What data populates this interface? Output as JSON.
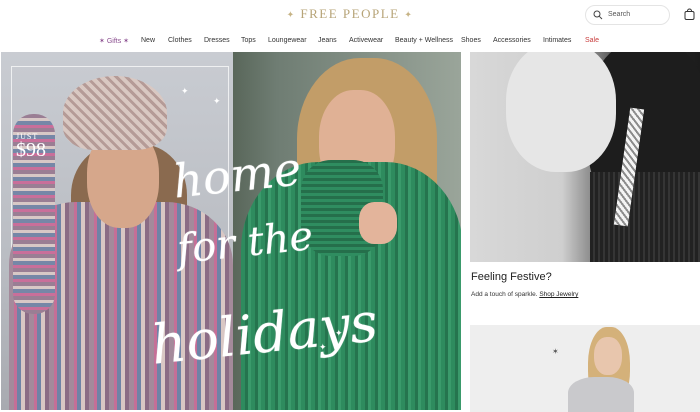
{
  "header": {
    "logo": "FREE PEOPLE",
    "search_placeholder": "Search"
  },
  "nav": {
    "items": [
      "Gifts",
      "New",
      "Clothes",
      "Dresses",
      "Tops",
      "Loungewear",
      "Jeans",
      "Activewear",
      "Beauty + Wellness",
      "Shoes",
      "Accessories",
      "Intimates",
      "Sale"
    ]
  },
  "hero": {
    "price_prefix": "JUST",
    "price": "$98",
    "script_line1": "home",
    "script_line2": "for the",
    "script_line3": "holidays"
  },
  "promo": {
    "title": "Feeling Festive?",
    "desc": "Add a touch of sparkle.",
    "link": "Shop Jewelry"
  },
  "icons": {
    "search": "search-icon",
    "bag": "shopping-bag-icon"
  },
  "colors": {
    "logo": "#b7a478",
    "gifts_nav": "#8a4d8f",
    "sale_nav": "#c83c3c"
  }
}
